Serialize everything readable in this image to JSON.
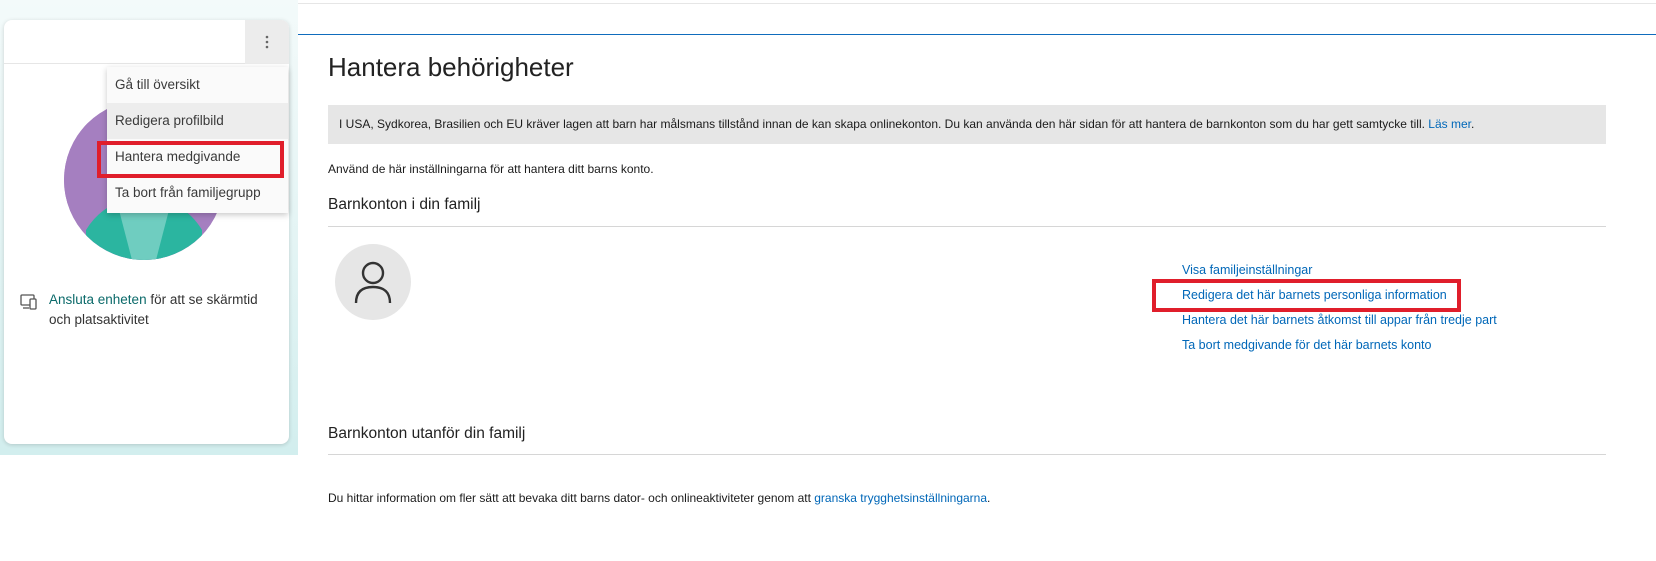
{
  "left_panel": {
    "menu_button_icon": "more-vertical-icon",
    "menu_items": [
      {
        "label": "Gå till översikt"
      },
      {
        "label": "Redigera profilbild"
      },
      {
        "label": "Hantera medgivande"
      },
      {
        "label": "Ta bort från familjegrupp"
      }
    ],
    "device_icon": "device-connect-icon",
    "device_link": "Ansluta enheten",
    "device_text": " för att se skärmtid och platsaktivitet"
  },
  "main": {
    "title": "Hantera behörigheter",
    "notice_text": "I USA, Sydkorea, Brasilien och EU kräver lagen att barn har målsmans tillstånd innan de kan skapa onlinekonton. Du kan använda den här sidan för att hantera de barnkonton som du har gett samtycke till. ",
    "notice_link": "Läs mer",
    "notice_end": ".",
    "intro": "Använd de här inställningarna för att hantera ditt barns konto.",
    "section_in_family": "Barnkonton i din familj",
    "child_avatar_icon": "person-icon",
    "actions": [
      {
        "label": "Visa familjeinställningar"
      },
      {
        "label": "Redigera det här barnets personliga information"
      },
      {
        "label": "Hantera det här barnets åtkomst till appar från tredje part"
      },
      {
        "label": "Ta bort medgivande för det här barnets konto"
      }
    ],
    "section_outside_family": "Barnkonton utanför din familj",
    "footer_text": "Du hittar information om fler sätt att bevaka ditt barns dator- och onlineaktiviteter genom att ",
    "footer_link": "granska trygghetsinställningarna",
    "footer_end": "."
  },
  "colors": {
    "accent_link": "#0067b8",
    "highlight_box": "#e01e2b",
    "avatar_purple": "#a57fc0",
    "avatar_teal": "#2bb5a0"
  }
}
